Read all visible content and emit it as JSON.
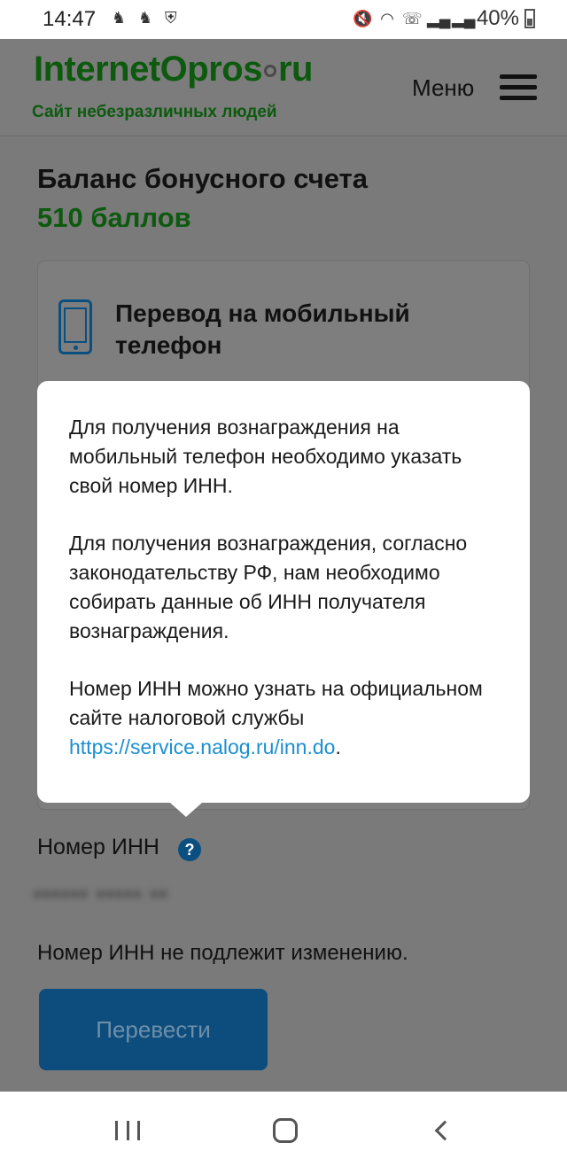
{
  "status_bar": {
    "time": "14:47",
    "left_icons": [
      "notification-icon",
      "notification-icon",
      "shield-app-icon"
    ],
    "right_icons": [
      "mute-icon",
      "wifi-icon",
      "call-icon",
      "signal-icon",
      "signal-icon"
    ],
    "battery_text": "40%"
  },
  "header": {
    "logo_main": "InternetOpros",
    "logo_tld": "ru",
    "tagline": "Сайт небезразличных людей",
    "menu_label": "Меню"
  },
  "balance": {
    "title": "Баланс бонусного счета",
    "value": "510 баллов"
  },
  "card": {
    "title": "Перевод на мобильный телефон",
    "icon": "mobile-phone-icon"
  },
  "popup": {
    "paragraph1": "Для получения вознаграждения на мобильный телефон необходимо указать свой номер ИНН.",
    "paragraph2": "Для получения вознаграждения, согласно законодательству РФ, нам необходимо собирать данные об ИНН получателя вознаграждения.",
    "paragraph3_prefix": "Номер ИНН можно узнать на официальном сайте налоговой службы ",
    "link_text": "https://service.nalog.ru/inn.do",
    "paragraph3_suffix": "."
  },
  "inn": {
    "label": "Номер ИНН",
    "help_glyph": "?",
    "value": "•••••• ••••• ••",
    "note": "Номер ИНН не подлежит изменению."
  },
  "actions": {
    "submit_label": "Перевести"
  }
}
